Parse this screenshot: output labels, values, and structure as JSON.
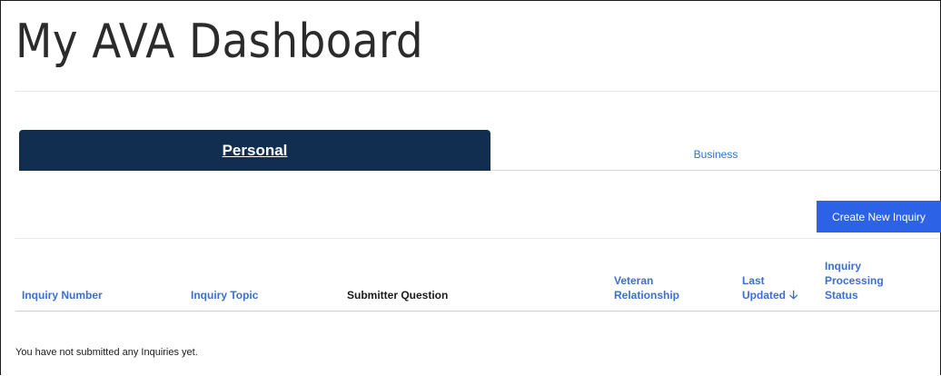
{
  "page": {
    "title": "My AVA Dashboard"
  },
  "tabs": [
    {
      "label": "Personal",
      "active": true
    },
    {
      "label": "Business",
      "active": false
    }
  ],
  "actions": {
    "create_label": "Create New Inquiry"
  },
  "table": {
    "columns": [
      {
        "line1": "Inquiry Number"
      },
      {
        "line1": "Inquiry Topic"
      },
      {
        "line1": "Submitter Question"
      },
      {
        "line1": "Veteran",
        "line2": "Relationship"
      },
      {
        "line1": "Last",
        "line2": "Updated"
      },
      {
        "line1": "Inquiry",
        "line2": "Processing",
        "line3": "Status"
      }
    ],
    "sort_icon": "arrow-down-icon",
    "empty_message": "You have not submitted any Inquiries yet."
  },
  "colors": {
    "tab_active_bg": "#112e51",
    "link": "#2e6fd6",
    "button_bg": "#2c63e6"
  }
}
